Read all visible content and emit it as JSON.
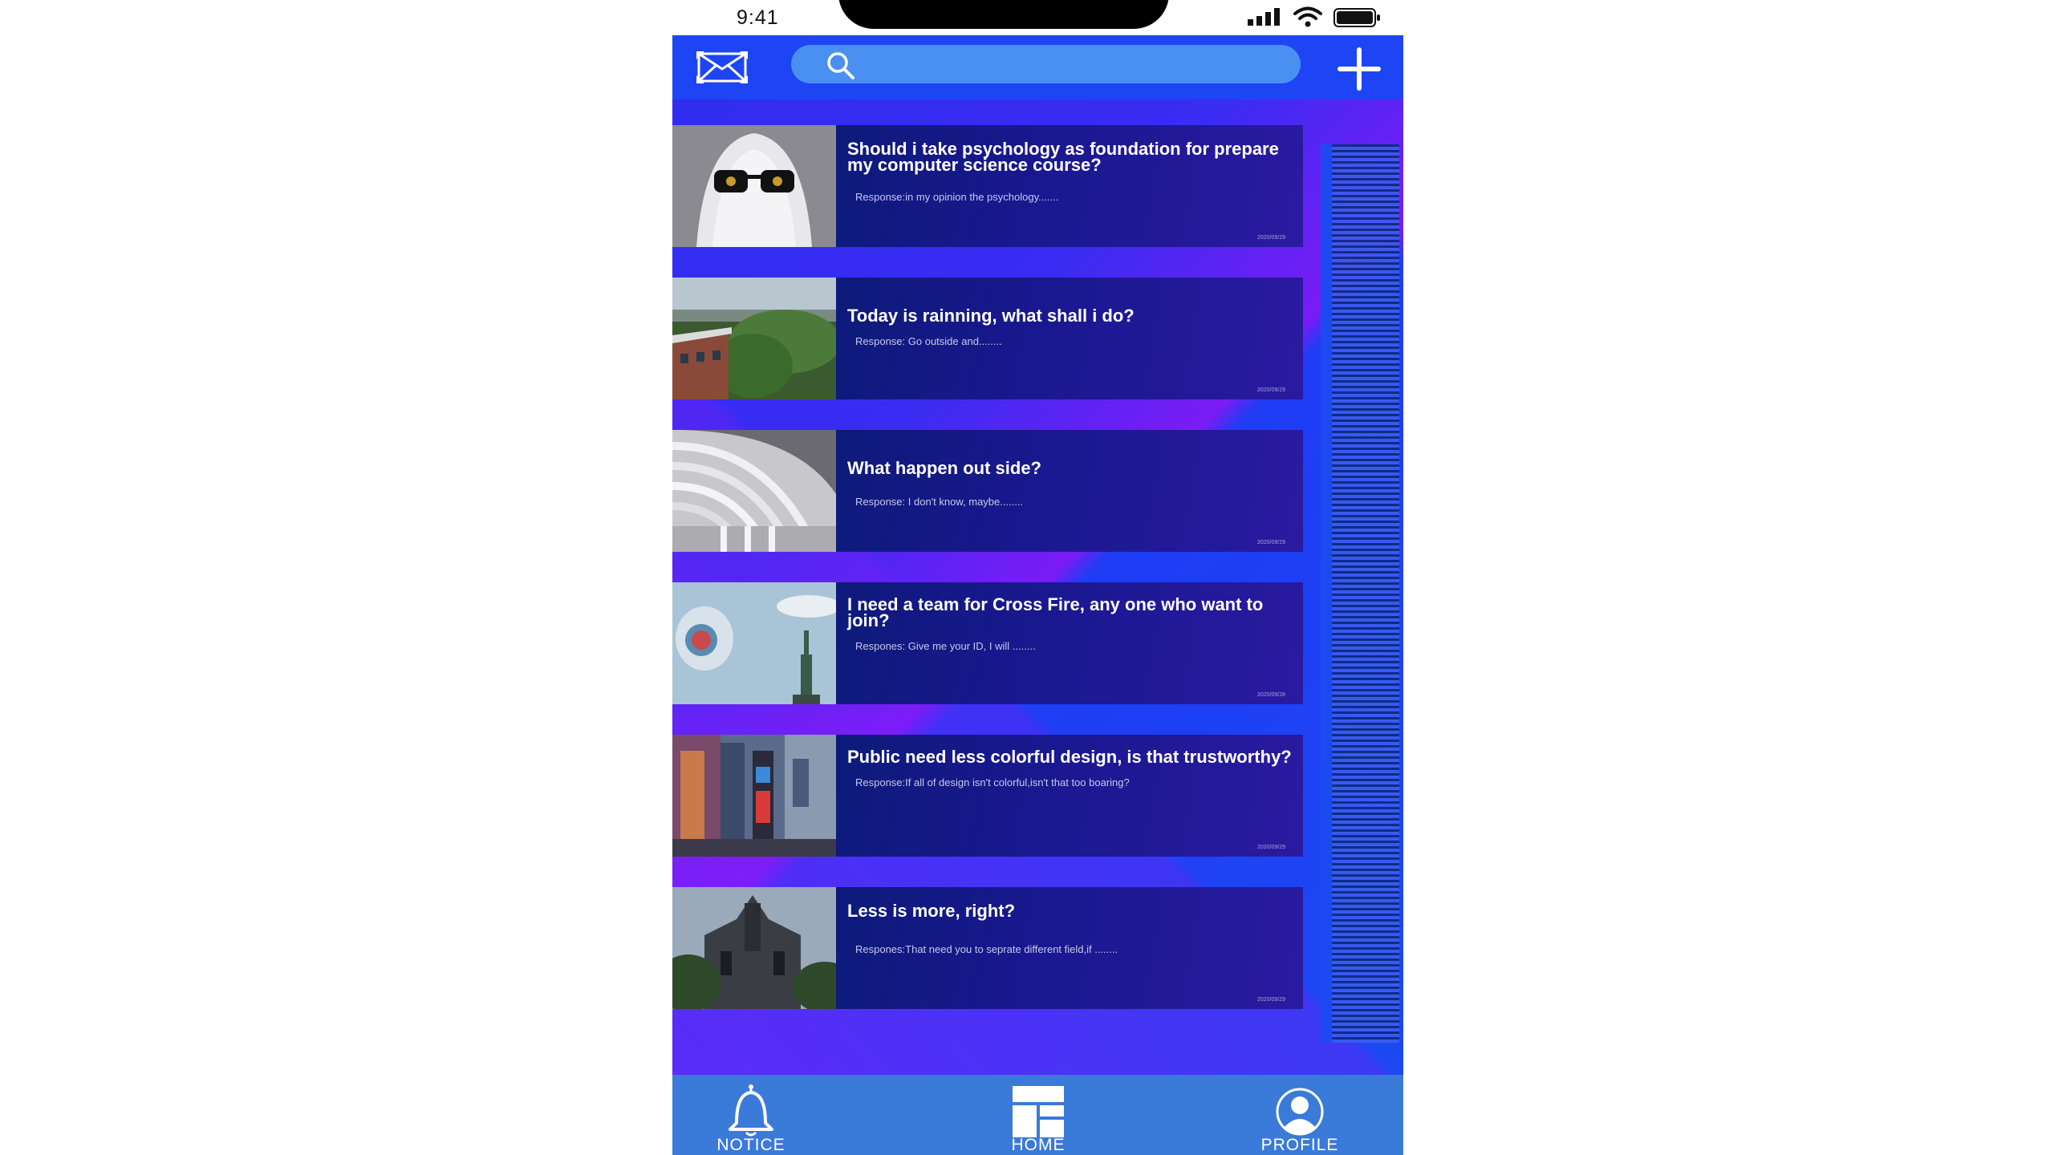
{
  "status_bar": {
    "time": "9:41"
  },
  "search": {
    "placeholder": "",
    "value": ""
  },
  "posts": [
    {
      "title": "Should i take psychology as foundation for prepare my computer science course?",
      "response": "Response:in my opinion the psychology.......",
      "date": "2020/09/29"
    },
    {
      "title": "Today is rainning, what shall i do?",
      "response": "Response: Go outside and........",
      "date": "2020/09/29"
    },
    {
      "title": "What happen out side?",
      "response": "Response: I don't know, maybe........",
      "date": "2020/09/29"
    },
    {
      "title": "I need a team for Cross Fire, any one who want to join?",
      "response": "Respones: Give me your ID, I will ........",
      "date": "2020/09/28"
    },
    {
      "title": "Public need less colorful design, is that trustworthy?",
      "response": "Response:If all of design isn't colorful,isn't that too boaring?",
      "date": "2020/09/29"
    },
    {
      "title": "Less is more, right?",
      "response": "Respones:That need you to seprate different field,if ........",
      "date": "2020/09/29"
    }
  ],
  "tabs": {
    "notice": "NOTICE",
    "home": "HOME",
    "profile": "PROFILE"
  },
  "colors": {
    "header": "#1e45f4",
    "tab_bar": "#3a7ad8",
    "search": "#4a8ff2",
    "card": "#1a1890"
  },
  "icons": {
    "header": [
      "mail-expand-icon",
      "search-icon",
      "plus-icon"
    ],
    "tabs": [
      "bell-icon",
      "home-grid-icon",
      "profile-icon"
    ]
  }
}
